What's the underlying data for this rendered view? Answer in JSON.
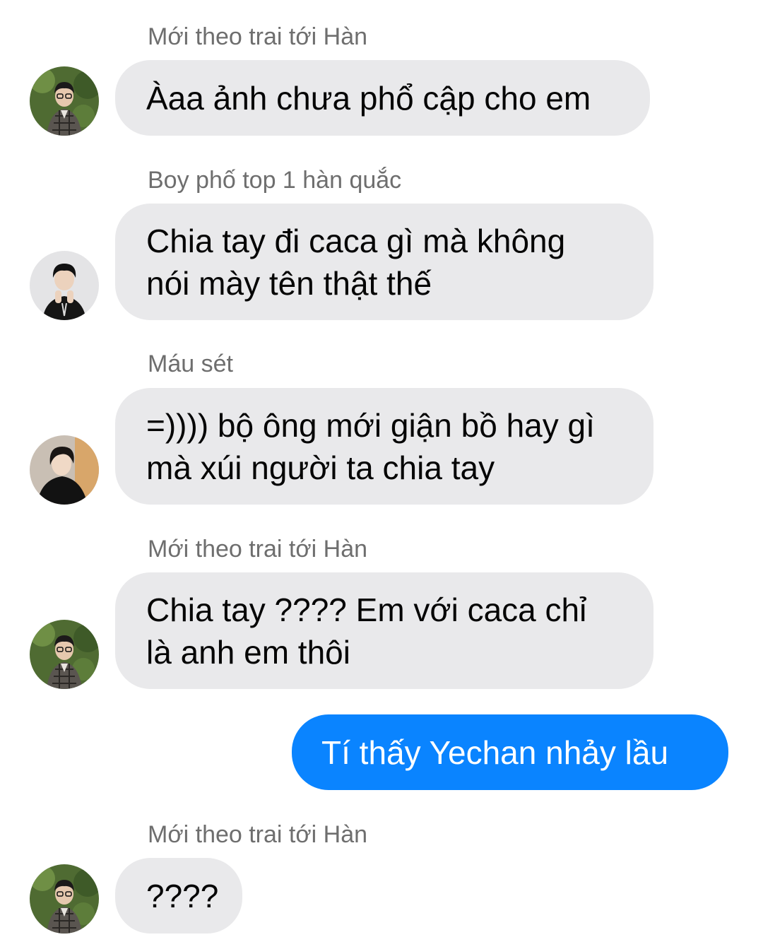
{
  "colors": {
    "incoming_bubble": "#e9e9eb",
    "outgoing_bubble": "#0a84ff",
    "sender_name": "#6e6e6e"
  },
  "messages": [
    {
      "sender": "Mới theo trai tới Hàn",
      "text": "Àaa ảnh chưa phổ cập cho em",
      "avatar": "avatar-glasses-plaid-shirt"
    },
    {
      "sender": "Boy phố top 1 hàn quắc",
      "text": "Chia tay đi caca gì mà không nói mày tên thật thế",
      "avatar": "avatar-dark-hair-hands-up"
    },
    {
      "sender": "Máu sét",
      "text": "=)))) bộ ông mới giận bồ hay gì mà xúi người ta chia tay",
      "avatar": "avatar-black-jacket"
    },
    {
      "sender": "Mới theo trai tới Hàn",
      "text": "Chia tay ???? Em với caca chỉ là anh em thôi",
      "avatar": "avatar-glasses-plaid-shirt"
    },
    {
      "sender": "",
      "text": "Tí thấy Yechan nhảy lầu",
      "avatar": ""
    },
    {
      "sender": "Mới theo trai tới Hàn",
      "text": "????",
      "avatar": "avatar-glasses-plaid-shirt"
    }
  ]
}
